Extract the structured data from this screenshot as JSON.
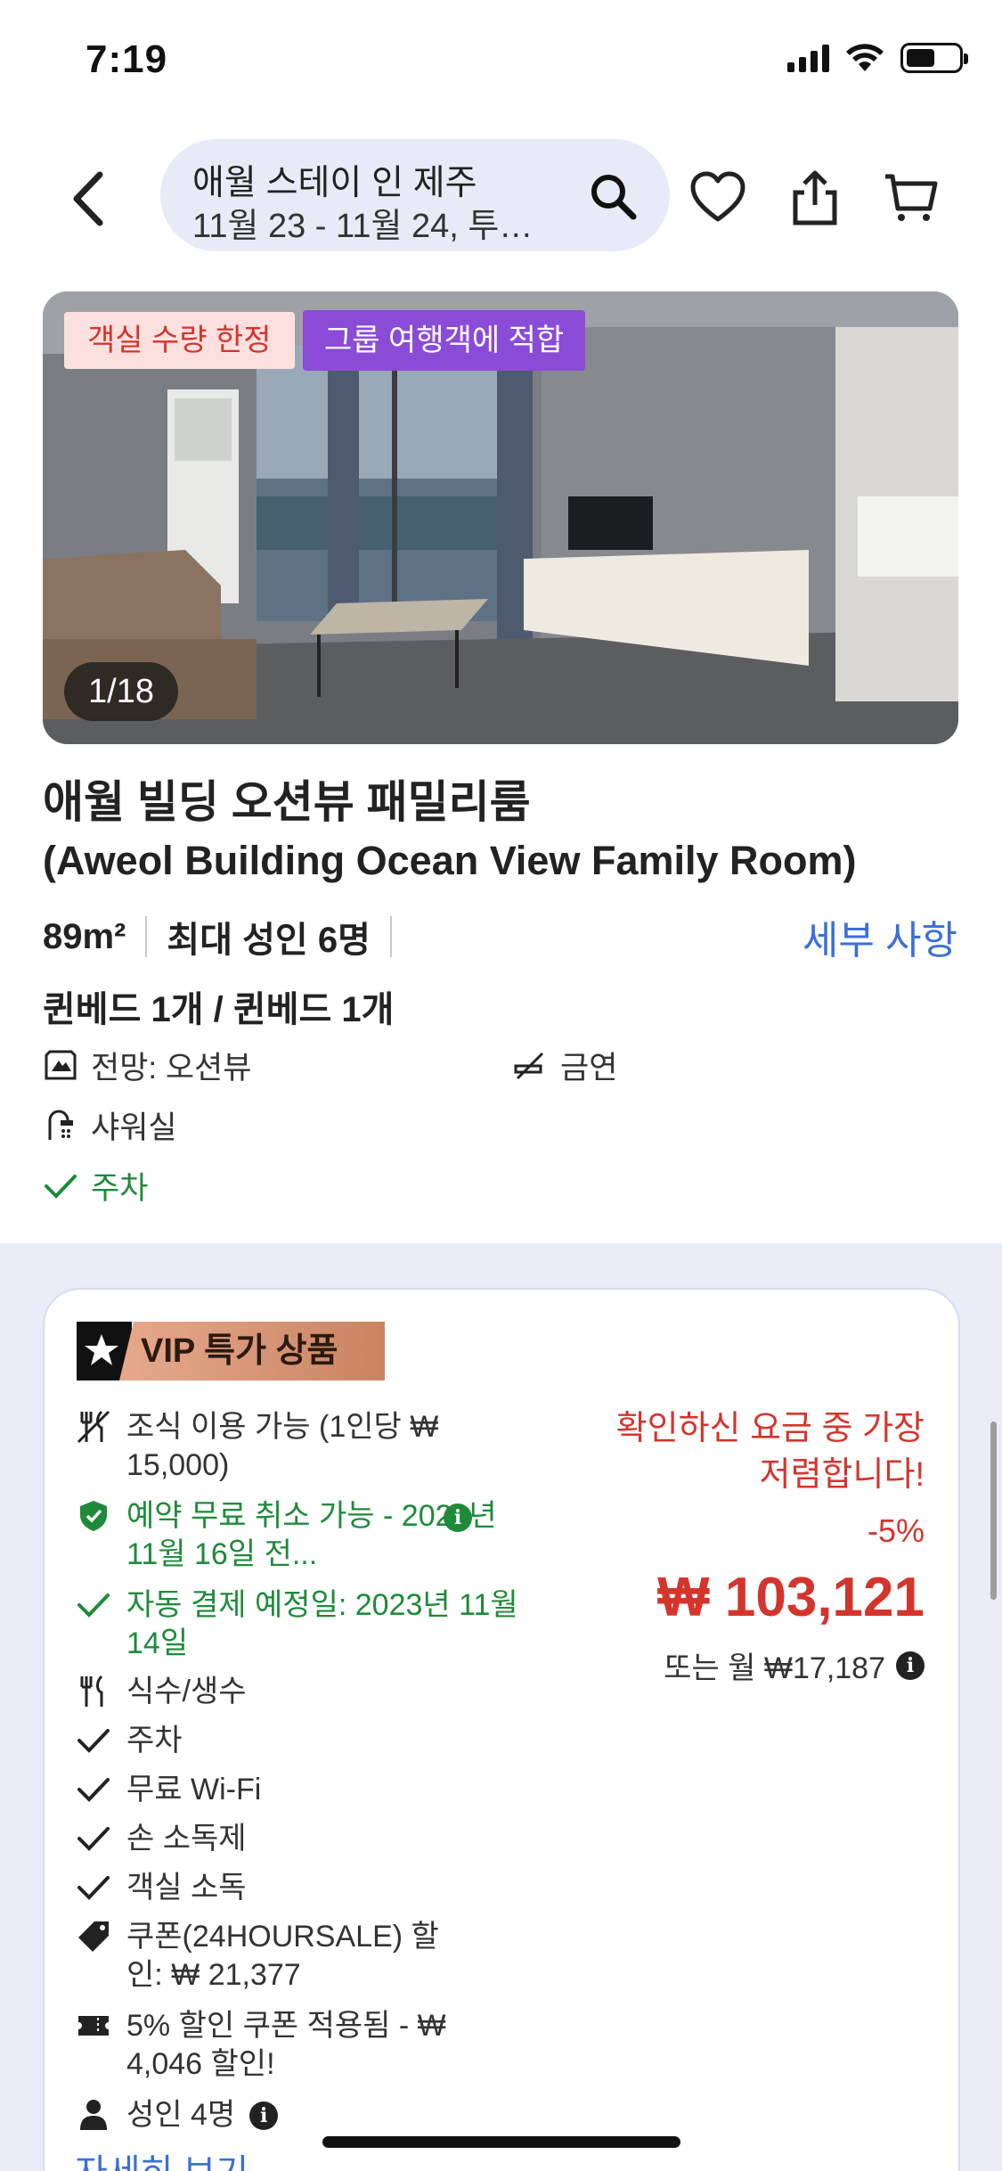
{
  "status_bar": {
    "time": "7:19"
  },
  "header": {
    "search_title": "애월 스테이 인 제주",
    "search_sub": "11월 23 - 11월 24, 투…"
  },
  "room": {
    "badges": {
      "limited": "객실 수량 한정",
      "group": "그룹 여행객에 적합"
    },
    "photo_counter": "1/18",
    "title": "애월 빌딩 오션뷰 패밀리룸",
    "title_en": "(Aweol Building Ocean View Family Room)",
    "size": "89m²",
    "max_guests": "최대 성인 6명",
    "details_link": "세부 사항",
    "beds": "퀸베드 1개 / 퀸베드 1개",
    "amenities": {
      "view": "전망: 오션뷰",
      "non_smoking": "금연",
      "shower": "샤워실",
      "parking": "주차"
    }
  },
  "offer": {
    "vip_label": "VIP 특가 상품",
    "features": {
      "breakfast": "조식 이용 가능 (1인당 ₩ 15,000)",
      "free_cancel": "예약 무료 취소 가능 - 2023년 11월 16일 전...",
      "auto_payment": "자동 결제 예정일: 2023년 11월 14일",
      "water": "식수/생수",
      "parking": "주차",
      "wifi": "무료 Wi-Fi",
      "sanitizer": "손 소독제",
      "disinfection": "객실 소독",
      "coupon": "쿠폰(24HOURSALE) 할인: ₩ 21,377",
      "coupon_applied": "5% 할인 쿠폰 적용됨 - ₩ 4,046 할인!",
      "adults": "성인 4명"
    },
    "price_note": "확인하신 요금 중 가장 저렴합니다!",
    "discount": "-5%",
    "price": "₩ 103,121",
    "monthly": "또는 월 ₩17,187",
    "more_link": "자세히 보기"
  },
  "colors": {
    "accent_red": "#d3352d",
    "accent_green": "#1e8a3a",
    "link_blue": "#3b6fd8",
    "group_purple": "#8a4bd6"
  }
}
